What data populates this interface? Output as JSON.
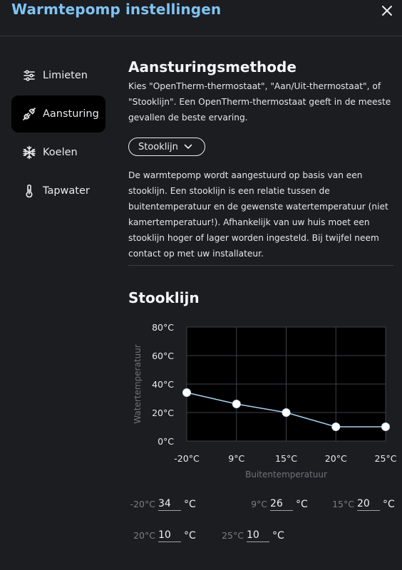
{
  "window": {
    "title": "Warmtepomp instellingen"
  },
  "sidebar": {
    "items": [
      {
        "label": "Limieten",
        "icon": "sliders-icon",
        "active": false
      },
      {
        "label": "Aansturing",
        "icon": "plug-icon",
        "active": true
      },
      {
        "label": "Koelen",
        "icon": "snowflake-icon",
        "active": false
      },
      {
        "label": "Tapwater",
        "icon": "thermometer-icon",
        "active": false
      }
    ]
  },
  "main": {
    "heading": "Aansturingsmethode",
    "intro": "Kies \"OpenTherm-thermostaat\", \"Aan/Uit-thermostaat\", of \"Stooklijn\". Een OpenTherm-thermostaat geeft in de meeste gevallen de beste ervaring.",
    "method_select": {
      "value": "Stooklijn"
    },
    "description": "De warmtepomp wordt aangestuurd op basis van een stooklijn. Een stooklijn is een relatie tussen de buitentemperatuur en de gewenste watertemperatuur (niet kamertemperatuur!). Afhankelijk van uw huis moet een stooklijn hoger of lager worden ingesteld. Bij twijfel neem contact op met uw installateur.",
    "curve_heading": "Stooklijn"
  },
  "chart_data": {
    "type": "line",
    "title": "",
    "xlabel": "Buitentemperatuur",
    "ylabel": "Watertemperatuur",
    "x_categories": [
      "-20°C",
      "9°C",
      "15°C",
      "20°C",
      "25°C"
    ],
    "y_ticks": [
      "0°C",
      "20°C",
      "40°C",
      "60°C",
      "80°C"
    ],
    "ylim": [
      0,
      80
    ],
    "grid": true,
    "series": [
      {
        "values": [
          34,
          26,
          20,
          10,
          10
        ],
        "color": "#a9d2f0"
      }
    ]
  },
  "curve_inputs": [
    {
      "label": "-20°C",
      "value": "34",
      "unit": "°C"
    },
    {
      "label": "9°C",
      "value": "26",
      "unit": "°C"
    },
    {
      "label": "15°C",
      "value": "20",
      "unit": "°C"
    },
    {
      "label": "20°C",
      "value": "10",
      "unit": "°C"
    },
    {
      "label": "25°C",
      "value": "10",
      "unit": "°C"
    }
  ],
  "colors": {
    "accent": "#7fc3f2",
    "background": "#1b1d21",
    "line": "#a9d2f0"
  }
}
